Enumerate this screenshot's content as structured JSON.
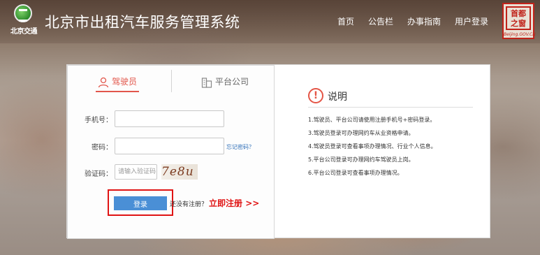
{
  "header": {
    "logo_text": "北京交通",
    "site_title": "北京市出租汽车服务管理系统",
    "nav": [
      "首页",
      "公告栏",
      "办事指南",
      "用户登录"
    ],
    "seal_text": "首都之窗",
    "seal_sub": "Beijing.GOV.CN"
  },
  "login": {
    "tabs": {
      "driver": "驾驶员",
      "company": "平台公司"
    },
    "phone_label": "手机号：",
    "password_label": "密码：",
    "forgot": "忘记密码？",
    "captcha_label": "验证码：",
    "captcha_placeholder": "请输入验证码",
    "captcha_text": "7e8u",
    "login_button": "登录",
    "no_account": "还没有注册？",
    "register_link": "立即注册 >>"
  },
  "help": {
    "title": "说明",
    "icon_symbol": "!",
    "items": [
      "1.驾驶员、平台公司请使用注册手机号+密码登录。",
      "3.驾驶员登录可办理网约车从业资格申请。",
      "4.驾驶员登录可查看事项办理情况、行业个人信息。",
      "5.平台公司登录可办理网约车驾驶员上岗。",
      "6.平台公司登录可查看事项办理情况。"
    ]
  },
  "colors": {
    "accent": "#e2564b",
    "button": "#4a8fd6",
    "highlight": "#e01414"
  }
}
